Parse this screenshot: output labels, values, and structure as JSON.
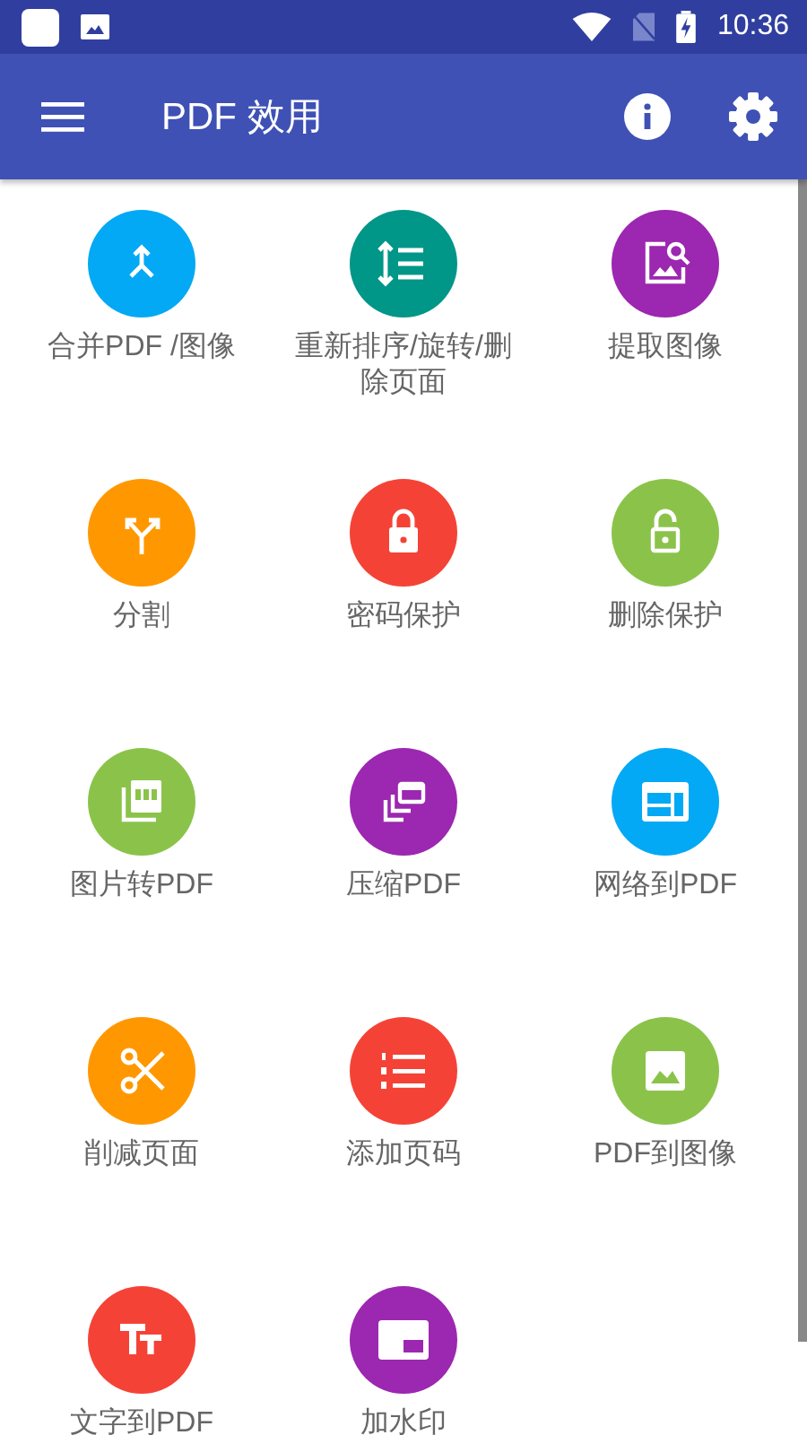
{
  "status_bar": {
    "time": "10:36"
  },
  "toolbar": {
    "title": "PDF 效用"
  },
  "tools": [
    {
      "label": "合并PDF /图像",
      "color": "#03a9f4"
    },
    {
      "label": "重新排序/旋转/删除页面",
      "color": "#009688"
    },
    {
      "label": "提取图像",
      "color": "#9c27b0"
    },
    {
      "label": "分割",
      "color": "#ff9800"
    },
    {
      "label": "密码保护",
      "color": "#f44336"
    },
    {
      "label": "删除保护",
      "color": "#8bc34a"
    },
    {
      "label": "图片转PDF",
      "color": "#8bc34a"
    },
    {
      "label": "压缩PDF",
      "color": "#9c27b0"
    },
    {
      "label": "网络到PDF",
      "color": "#03a9f4"
    },
    {
      "label": "削减页面",
      "color": "#ff9800"
    },
    {
      "label": "添加页码",
      "color": "#f44336"
    },
    {
      "label": "PDF到图像",
      "color": "#8bc34a"
    },
    {
      "label": "文字到PDF",
      "color": "#f44336"
    },
    {
      "label": "加水印",
      "color": "#9c27b0"
    }
  ]
}
